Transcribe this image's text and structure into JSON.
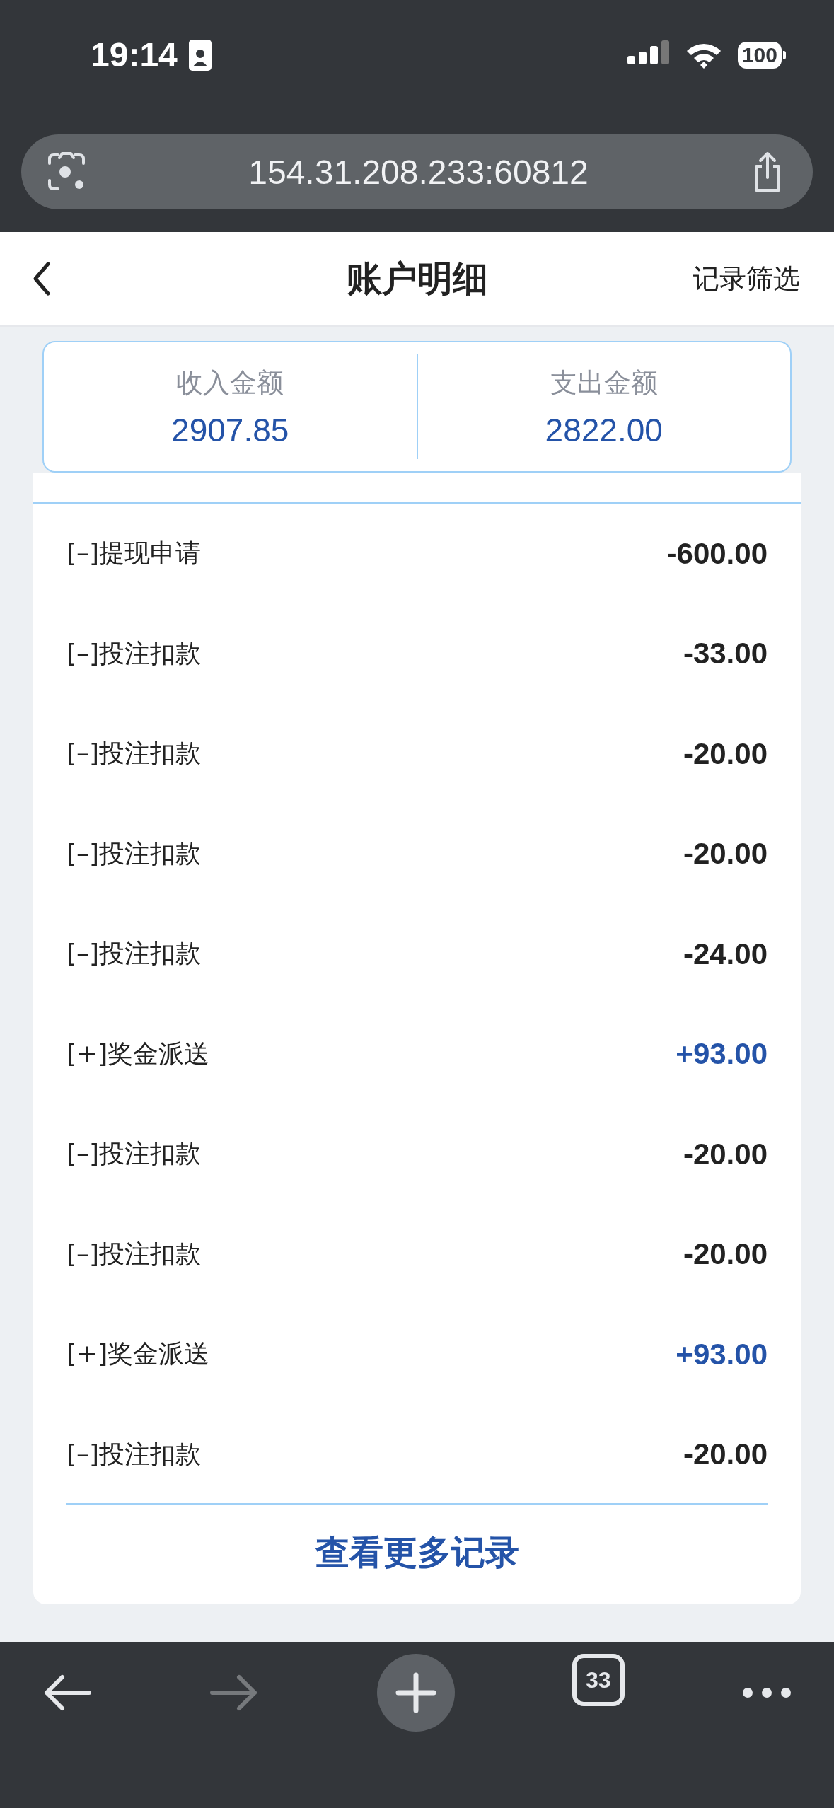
{
  "status_bar": {
    "time": "19:14",
    "battery": "100"
  },
  "address_bar": {
    "url": "154.31.208.233:60812"
  },
  "header": {
    "title": "账户明细",
    "action": "记录筛选"
  },
  "summary": [
    {
      "label": "收入金额",
      "value": "2907.85"
    },
    {
      "label": "支出金额",
      "value": "2822.00"
    }
  ],
  "records": [
    {
      "label": "[–]提现申请",
      "amount": "-600.00",
      "kind": "expense"
    },
    {
      "label": "[–]投注扣款",
      "amount": "-33.00",
      "kind": "expense"
    },
    {
      "label": "[–]投注扣款",
      "amount": "-20.00",
      "kind": "expense"
    },
    {
      "label": "[–]投注扣款",
      "amount": "-20.00",
      "kind": "expense"
    },
    {
      "label": "[–]投注扣款",
      "amount": "-24.00",
      "kind": "expense"
    },
    {
      "label": "[+]奖金派送",
      "amount": "+93.00",
      "kind": "income"
    },
    {
      "label": "[–]投注扣款",
      "amount": "-20.00",
      "kind": "expense"
    },
    {
      "label": "[–]投注扣款",
      "amount": "-20.00",
      "kind": "expense"
    },
    {
      "label": "[+]奖金派送",
      "amount": "+93.00",
      "kind": "income"
    },
    {
      "label": "[–]投注扣款",
      "amount": "-20.00",
      "kind": "expense"
    }
  ],
  "more_link": "查看更多记录",
  "toolbar": {
    "forward_disabled": true,
    "tab_count": "33"
  }
}
